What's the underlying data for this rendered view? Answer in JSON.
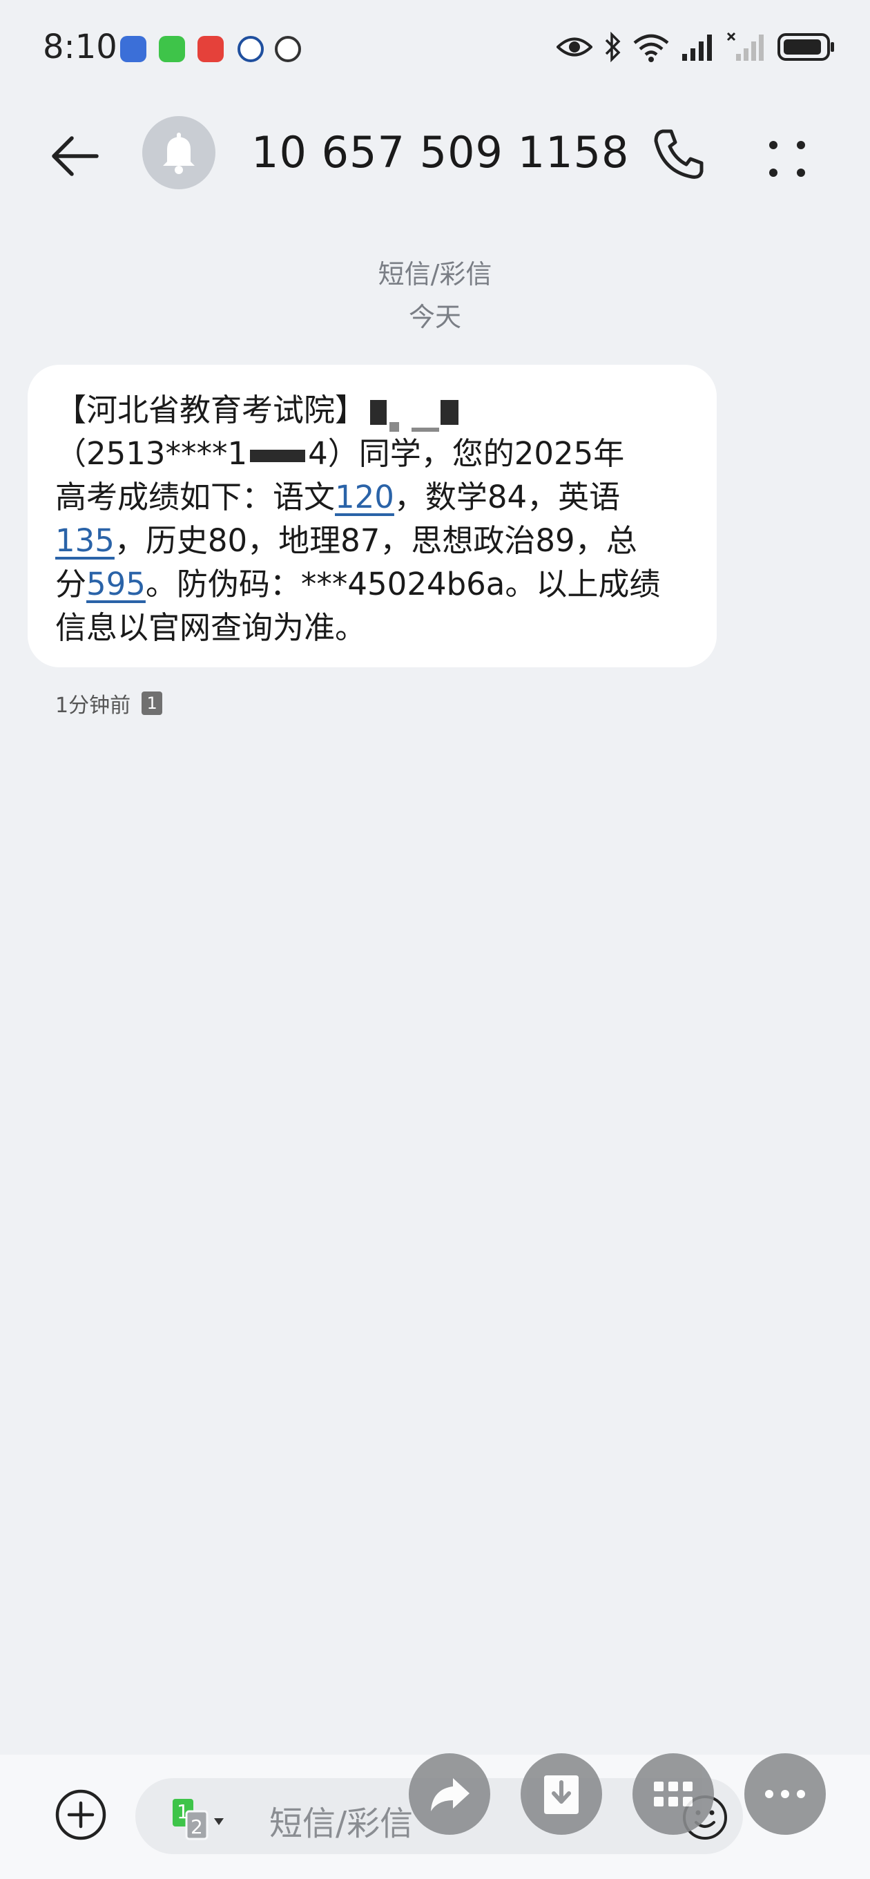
{
  "status_bar": {
    "time": "8:10",
    "app_icons": [
      "baidu-icon",
      "wechat-icon",
      "huawei-app-icon",
      "cmb-icon",
      "unicom-icon"
    ],
    "right_icons": [
      "eye-icon",
      "bluetooth-icon",
      "wifi-icon",
      "signal-icon",
      "signal-off-icon",
      "battery-icon"
    ]
  },
  "header": {
    "contact": "10 657 509 1158"
  },
  "separator": {
    "type": "短信/彩信",
    "date": "今天"
  },
  "message": {
    "line1_text": "【河北省教育考试院】",
    "line2_a": "（2513****1",
    "line2_b": "4）同学，您的2025年",
    "line3_a": "高考成绩如下：语文",
    "line3_link": "120",
    "line3_b": "，数学84，英语",
    "line4_link": "135",
    "line4_b": "，历史80，地理87，思想政治89，总",
    "line5_a": "分",
    "line5_link": "595",
    "line5_b": "。防伪码：***45024b6a。以上成绩",
    "line6": "信息以官网查询为准。",
    "time_ago": "1分钟前",
    "sim": "1"
  },
  "compose": {
    "placeholder": "短信/彩信",
    "sim_primary": "1",
    "sim_secondary": "2"
  },
  "colors": {
    "background": "#eff1f4",
    "bubble": "#ffffff",
    "link": "#2a63a8",
    "fab": "#8a8c8f"
  }
}
